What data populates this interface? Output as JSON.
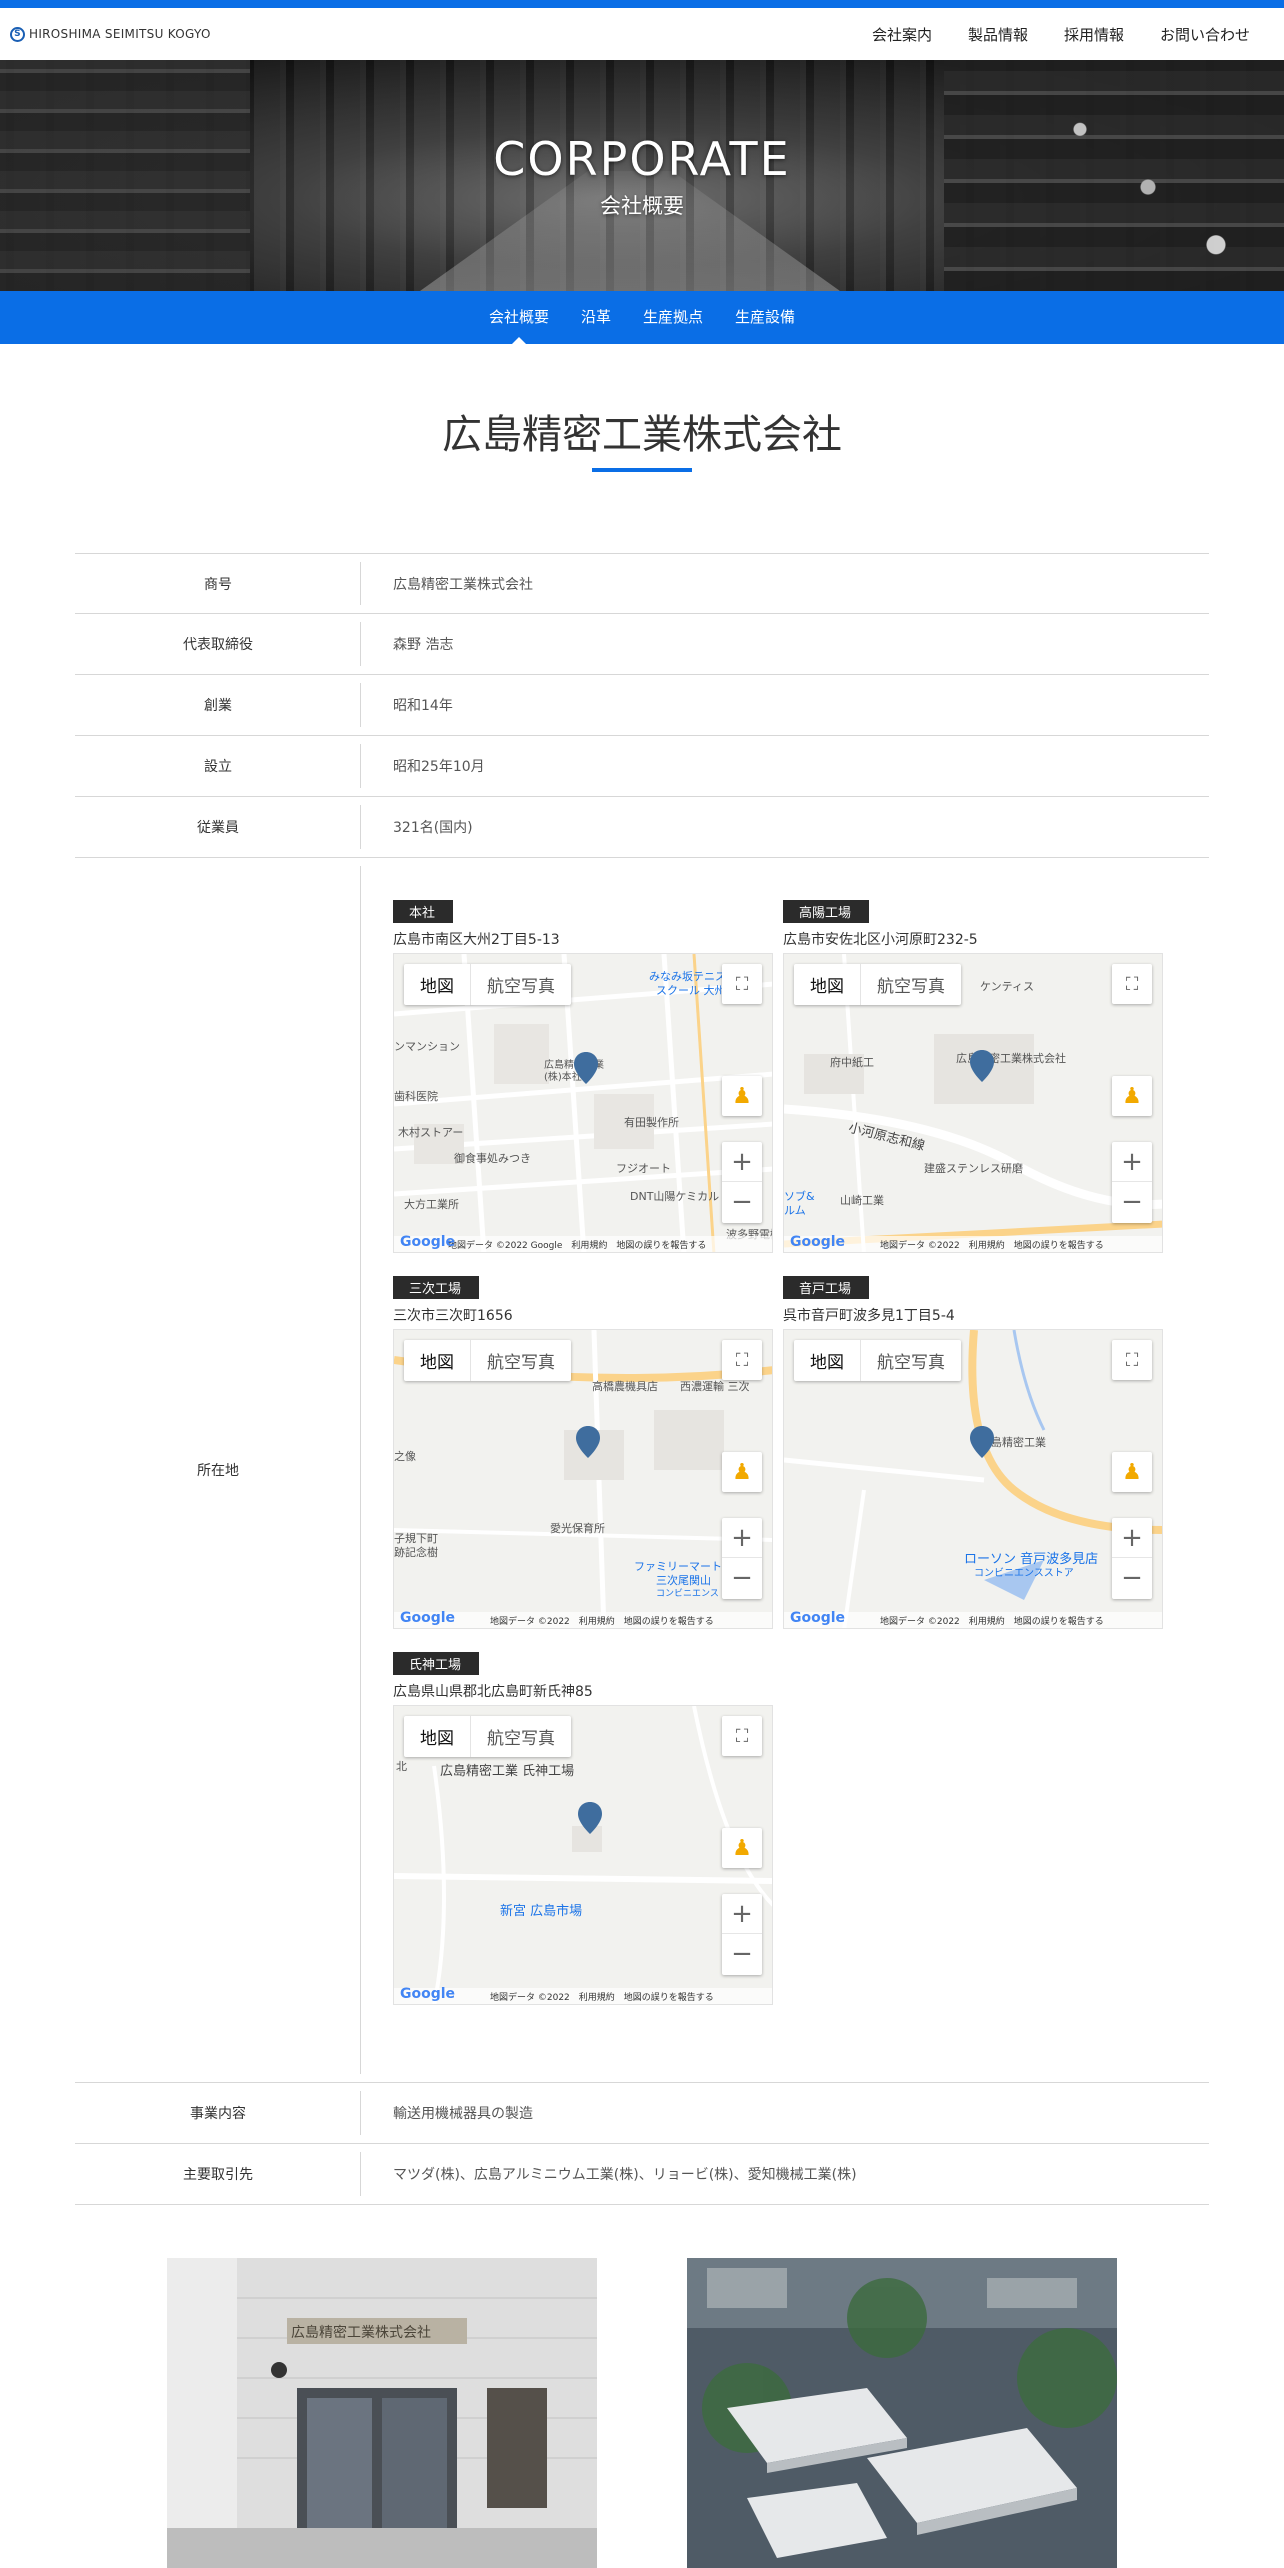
{
  "header": {
    "logo_mark": "S",
    "logo_text": "HIROSHIMA SEIMITSU KOGYO",
    "nav": [
      "会社案内",
      "製品情報",
      "採用情報",
      "お問い合わせ"
    ]
  },
  "hero": {
    "title": "CORPORATE",
    "subtitle": "会社概要"
  },
  "subnav": [
    "会社概要",
    "沿革",
    "生産拠点",
    "生産設備"
  ],
  "page_title": "広島精密工業株式会社",
  "info_rows": [
    {
      "label": "商号",
      "value": "広島精密工業株式会社"
    },
    {
      "label": "代表取締役",
      "value": "森野 浩志"
    },
    {
      "label": "創業",
      "value": "昭和14年"
    },
    {
      "label": "設立",
      "value": "昭和25年10月"
    },
    {
      "label": "従業員",
      "value": "321名(国内)"
    }
  ],
  "location": {
    "label": "所在地",
    "sites": [
      {
        "name": "本社",
        "address": "広島市南区大州2丁目5-13"
      },
      {
        "name": "高陽工場",
        "address": "広島市安佐北区小河原町232-5"
      },
      {
        "name": "三次工場",
        "address": "三次市三次町1656"
      },
      {
        "name": "音戸工場",
        "address": "呉市音戸町波多見1丁目5-4"
      },
      {
        "name": "氏神工場",
        "address": "広島県山県郡北広島町新氏神85"
      }
    ],
    "map_ui": {
      "map_button": "地図",
      "satellite_button": "航空写真",
      "google": "Google",
      "footer": "地図データ ©2022 Google　利用規約　地図の誤りを報告する",
      "footer_short": "地図データ ©2022　利用規約　地図の誤りを報告する"
    },
    "map_labels": {
      "m1": [
        "みなみ坂テニス",
        "スクール 大州",
        "広島精密工業",
        "(株)本社",
        "ンマンション",
        "歯科医院",
        "木村ストアー",
        "御食事処みつき",
        "有田製作所",
        "フジオート",
        "大方工業所",
        "DNT山陽ケミカル",
        "波多野電機"
      ],
      "m2": [
        "府中紙工",
        "広島精密工業株式会社",
        "小河原志和線",
        "ケンティス",
        "建盛ステンレス研磨",
        "山崎工業",
        "ソブ&",
        "ルム"
      ],
      "m3": [
        "高橋農機具店",
        "西濃運輸 三次",
        "愛光保育所",
        "ファミリーマート",
        "三次尾関山",
        "コンビニエンス",
        "子規下町",
        "跡記念樹",
        "之像"
      ],
      "m4": [
        "広島精密工業",
        "ローソン 音戸波多見店",
        "コンビニエンスストア"
      ],
      "m5": [
        "広島精密工業 氏神工場",
        "新宮 広島市場",
        "北"
      ]
    }
  },
  "business_rows": [
    {
      "label": "事業内容",
      "value": "輸送用機械器具の製造"
    },
    {
      "label": "主要取引先",
      "value": "マツダ(株)、広島アルミニウム工業(株)、リョービ(株)、愛知機械工業(株)"
    }
  ],
  "photo_text": "広島精密工業株式会社",
  "colors": {
    "accent": "#0a6ee6",
    "label_bg": "#2b2b2b",
    "pin": "#3f6d9e"
  }
}
